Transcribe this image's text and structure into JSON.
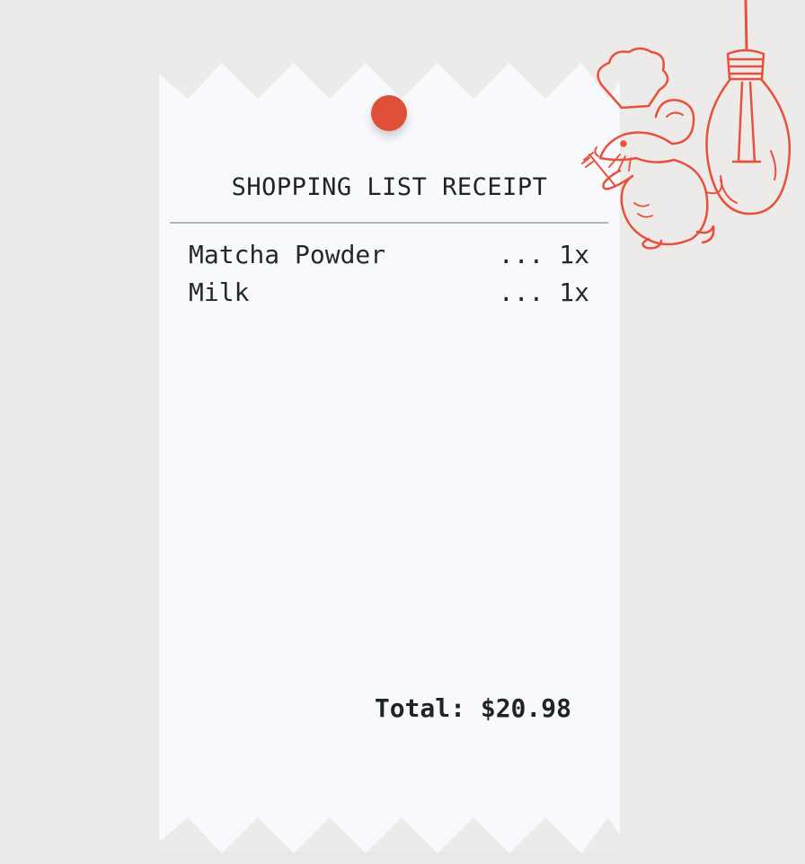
{
  "receipt": {
    "title": "SHOPPING LIST RECEIPT",
    "items": [
      {
        "name": "Matcha Powder",
        "qty": "... 1x"
      },
      {
        "name": "Milk",
        "qty": "... 1x"
      }
    ],
    "total": "Total: $20.98"
  },
  "colors": {
    "accent": "#e04f38",
    "paper": "#f7f9fc",
    "background": "#edebe9"
  },
  "icons": {
    "pin": "pin-icon",
    "illustration": "chef-mouse-lightbulb-illustration"
  }
}
